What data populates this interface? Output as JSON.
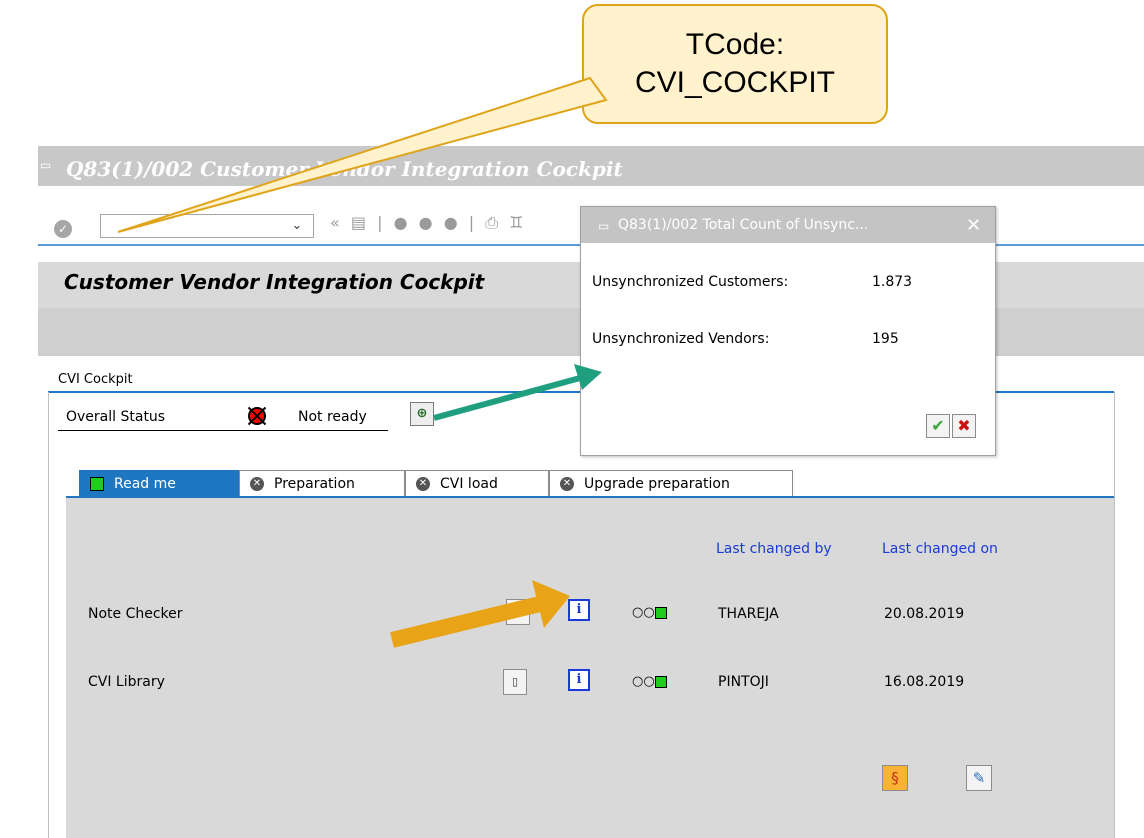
{
  "callout": {
    "line1": "TCode:",
    "line2": "CVI_COCKPIT"
  },
  "window": {
    "title": "Q83(1)/002 Customer Vendor Integration Cockpit"
  },
  "toolbar": {
    "command_value": ""
  },
  "header": {
    "title": "Customer Vendor Integration Cockpit"
  },
  "group": {
    "label": "CVI Cockpit"
  },
  "overall": {
    "label": "Overall Status",
    "value": "Not ready"
  },
  "tabs": [
    {
      "label": "Read me",
      "icon": "green-square-icon"
    },
    {
      "label": "Preparation",
      "icon": "grey-cross-icon"
    },
    {
      "label": "CVI load",
      "icon": "grey-cross-icon"
    },
    {
      "label": "Upgrade preparation",
      "icon": "grey-cross-icon"
    }
  ],
  "table": {
    "col_changed_by": "Last changed by",
    "col_changed_on": "Last changed on",
    "rows": [
      {
        "name": "Note Checker",
        "changed_by": "THAREJA",
        "changed_on": "20.08.2019"
      },
      {
        "name": "CVI Library",
        "changed_by": "PINTOJI",
        "changed_on": "16.08.2019"
      }
    ]
  },
  "popup": {
    "title": "Q83(1)/002 Total Count of Unsync...",
    "customers_label": "Unsynchronized Customers:",
    "customers_value": "1.873",
    "vendors_label": "Unsynchronized Vendors:",
    "vendors_value": "195"
  },
  "colors": {
    "accent": "#1f77c2",
    "callout_fill": "#fff2cc",
    "callout_border": "#e0a41a",
    "arrow_orange": "#e8a317",
    "arrow_teal": "#1f9e80"
  }
}
